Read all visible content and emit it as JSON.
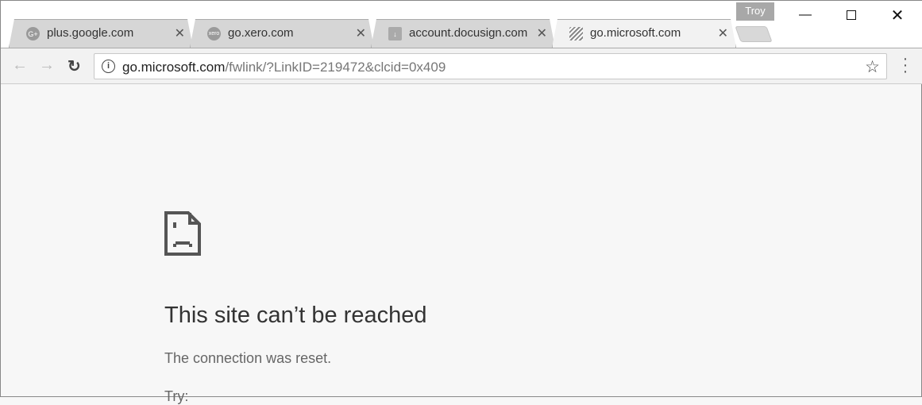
{
  "window": {
    "profile": "Troy",
    "minimize_icon": "minimize-icon",
    "maximize_icon": "maximize-icon",
    "close_icon": "close-icon"
  },
  "tabs": [
    {
      "label": "plus.google.com",
      "favicon": "G+",
      "active": false
    },
    {
      "label": "go.xero.com",
      "favicon": "xero",
      "active": false
    },
    {
      "label": "account.docusign.com",
      "favicon": "download-icon",
      "active": false
    },
    {
      "label": "go.microsoft.com",
      "favicon": "microsoft-icon",
      "active": true
    }
  ],
  "toolbar": {
    "url_host": "go.microsoft.com",
    "url_path": "/fwlink/?LinkID=219472&clcid=0x409"
  },
  "error": {
    "title": "This site can’t be reached",
    "message": "The connection was reset.",
    "try": "Try:"
  }
}
